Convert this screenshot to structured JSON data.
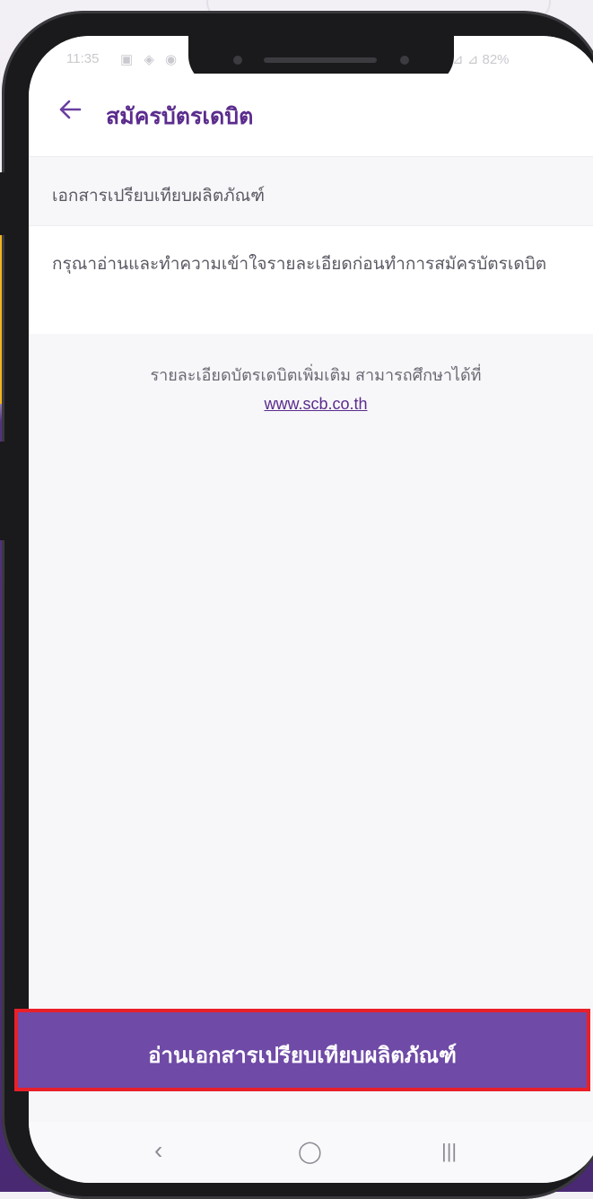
{
  "status_bar": {
    "time": "11:35",
    "left_icons": "▣ ◈ ◉",
    "right_text": "⊿ ⊿ 82%"
  },
  "app_bar": {
    "title": "สมัครบัตรเดบิต",
    "back_icon": "arrow-left-icon"
  },
  "section_header": "เอกสารเปรียบเทียบผลิตภัณฑ์",
  "description": "กรุณาอ่านและทำความเข้าใจรายละเอียดก่อนทำการสมัครบัตรเดบิต",
  "info": {
    "text": "รายละเอียดบัตรเดบิตเพิ่มเติม สามารถศึกษาได้ที่",
    "link": "www.scb.co.th"
  },
  "cta_button": "อ่านเอกสารเปรียบเทียบผลิตภัณฑ์",
  "nav_bar": {
    "back": "‹",
    "home": "◯",
    "recents": "|||"
  },
  "colors": {
    "brand_purple": "#5b2c8d",
    "button_purple": "#6f4aa6",
    "highlight_red": "#e8202a",
    "background_purple": "#4a2973",
    "accent_yellow": "#f2b31e"
  }
}
